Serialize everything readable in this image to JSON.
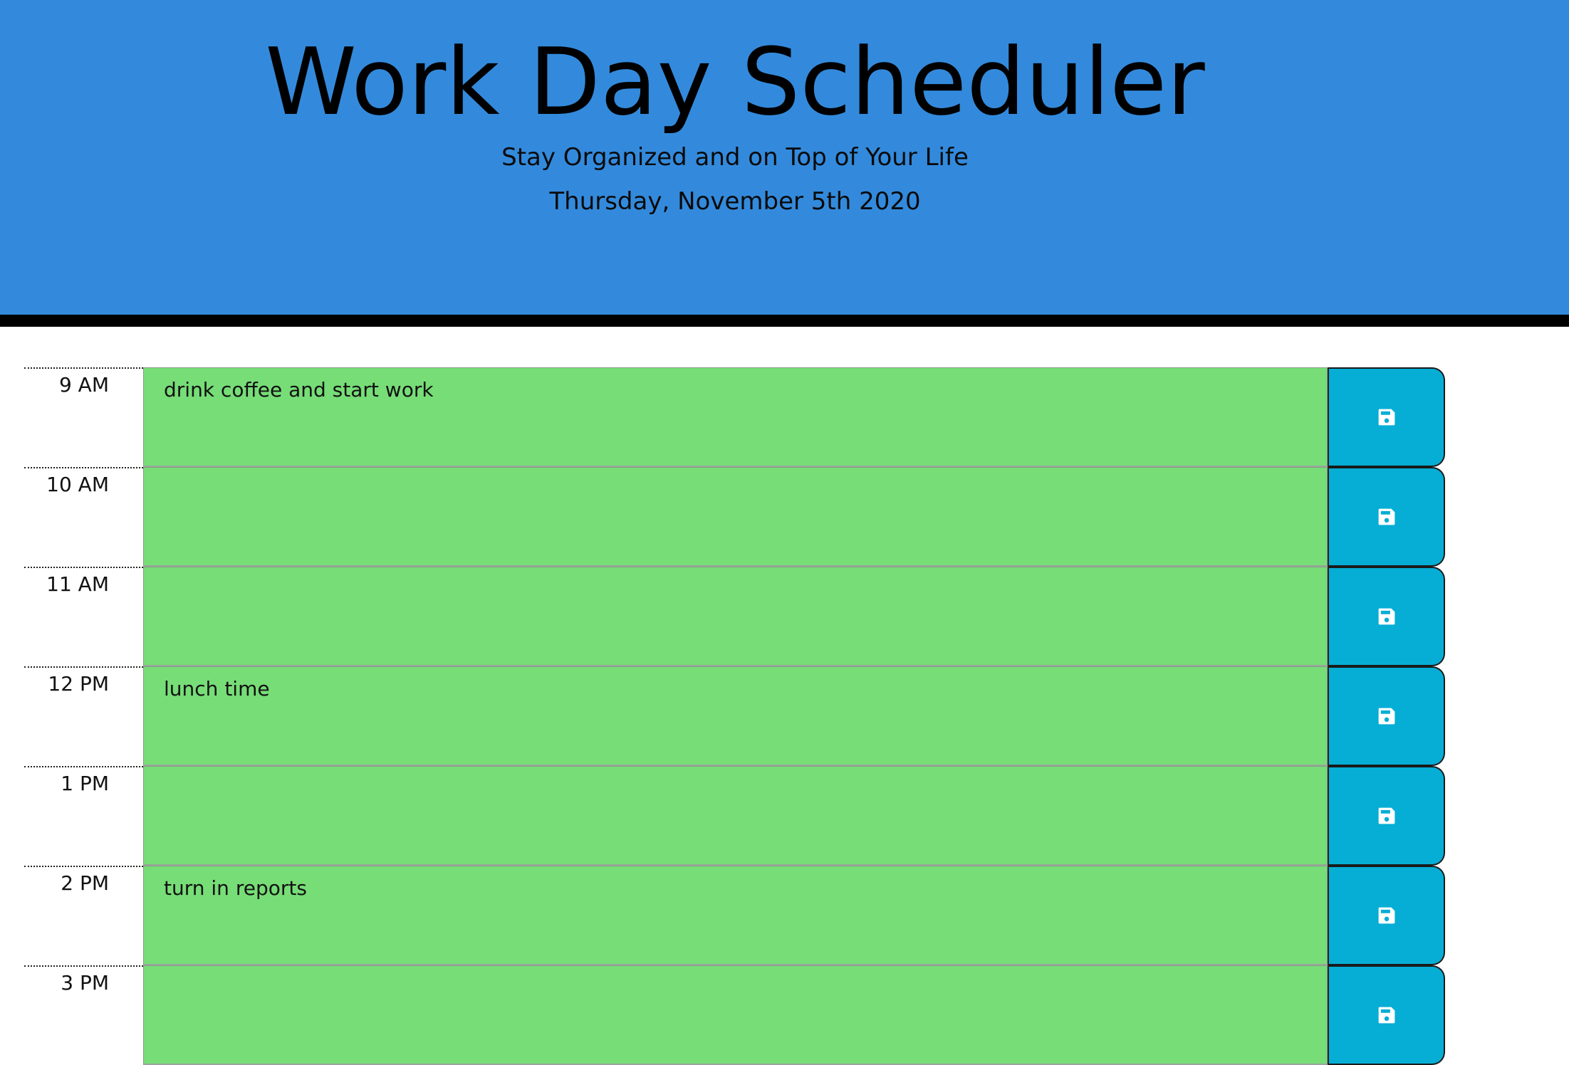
{
  "header": {
    "title": "Work Day Scheduler",
    "subtitle": "Stay Organized and on Top of Your Life",
    "current_date": "Thursday, November 5th 2020"
  },
  "colors": {
    "header_bg": "#338ADC",
    "future_row": "#77DD77",
    "save_button": "#06AED5"
  },
  "time_blocks": [
    {
      "hour": "9 AM",
      "text": "drink coffee and start work",
      "status": "future",
      "icon": "floppy-disk-icon"
    },
    {
      "hour": "10 AM",
      "text": "",
      "status": "future",
      "icon": "floppy-disk-icon"
    },
    {
      "hour": "11 AM",
      "text": "",
      "status": "future",
      "icon": "floppy-disk-icon"
    },
    {
      "hour": "12 PM",
      "text": "lunch time",
      "status": "future",
      "icon": "floppy-disk-icon"
    },
    {
      "hour": "1 PM",
      "text": "",
      "status": "future",
      "icon": "floppy-disk-icon"
    },
    {
      "hour": "2 PM",
      "text": "turn in reports",
      "status": "future",
      "icon": "floppy-disk-icon"
    },
    {
      "hour": "3 PM",
      "text": "",
      "status": "future",
      "icon": "floppy-disk-icon"
    }
  ]
}
